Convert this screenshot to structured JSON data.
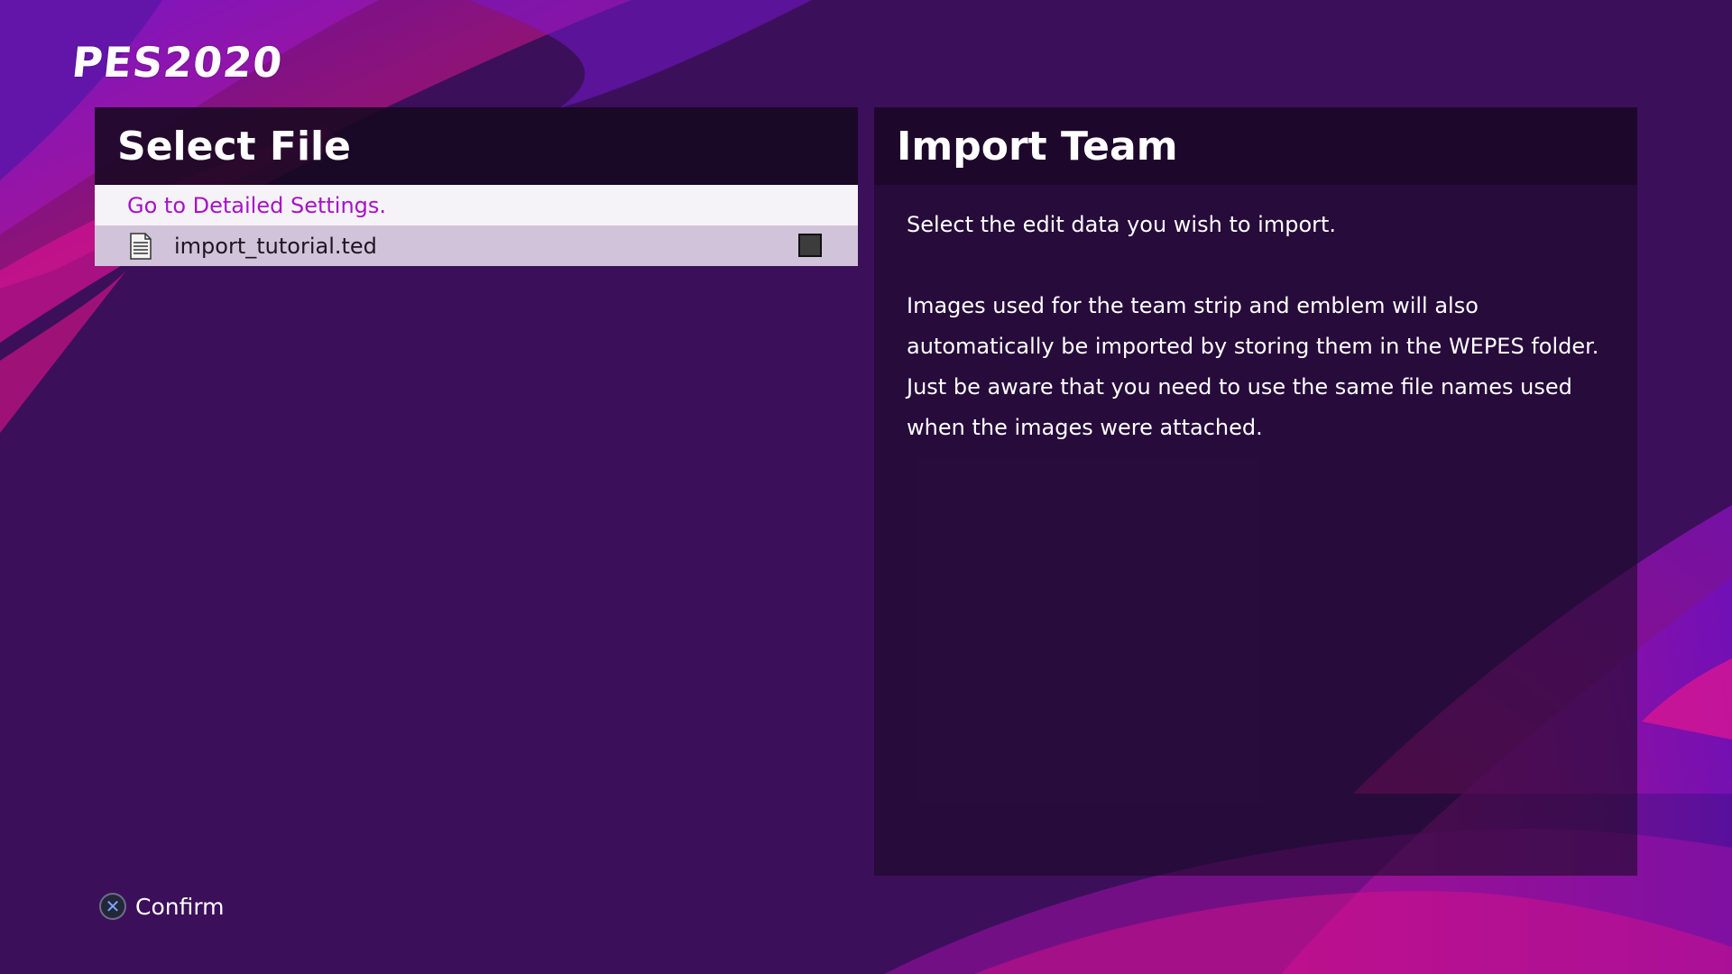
{
  "app": {
    "logo_text": "PES2020"
  },
  "select_panel": {
    "title": "Select File",
    "settings_link": "Go to Detailed Settings.",
    "files": [
      {
        "name": "import_tutorial.ted",
        "icon": "document-icon",
        "checked": false
      }
    ]
  },
  "info_panel": {
    "title": "Import Team",
    "paragraph1": "Select the edit data you wish to import.",
    "paragraph2_lines": [
      "Images used for the team strip and emblem will also",
      "automatically be imported by storing them in the WEPES folder.",
      "Just be aware that you need to use the same file names used",
      "when the images were attached."
    ]
  },
  "footer": {
    "confirm_button_icon": "cross-button-icon",
    "confirm_label": "Confirm"
  },
  "colors": {
    "background": "#3c0f5b",
    "accent_magenta": "#d0108c",
    "accent_purple": "#7a16d6",
    "link_text": "#a812c8",
    "selected_row": "#d1c3da"
  }
}
